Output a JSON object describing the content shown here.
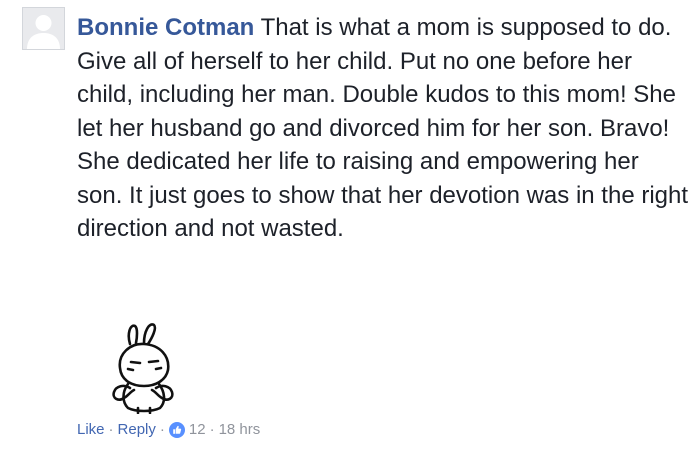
{
  "comment": {
    "author": "Bonnie Cotman",
    "text": "That is what a mom is supposed to do. Give all of herself to her child. Put no one before her child, including her man. Double kudos to this mom! She let her husband go and divorced him for her son. Bravo! She dedicated her life to raising and empowering her son. It just goes to show that her devotion was in the right direction and not wasted.",
    "like_label": "Like",
    "reply_label": "Reply",
    "separator": "·",
    "reaction_count": "12",
    "timestamp": "18 hrs"
  },
  "icons": {
    "avatar": "default-profile-silhouette",
    "sticker": "bunny-sticker",
    "reaction": "thumbs-up-reaction-icon"
  },
  "colors": {
    "author": "#365899",
    "link": "#4267b2",
    "meta": "#90949c",
    "text": "#1d2129",
    "reaction_blue": "#5890ff"
  }
}
